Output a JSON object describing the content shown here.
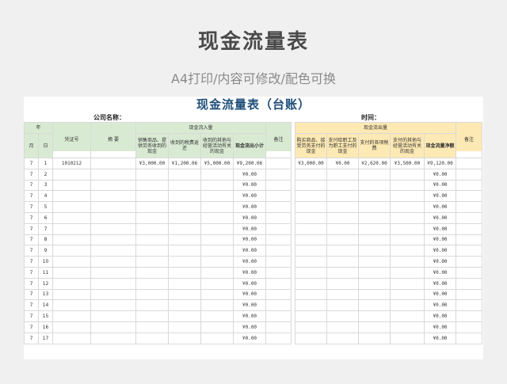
{
  "page": {
    "title": "现金流量表",
    "subtitle": "A4打印/内容可修改/配色可换"
  },
  "sheet": {
    "title": "现金流量表（台账）",
    "company_label": "公司名称：",
    "time_label": "时间："
  },
  "left_table": {
    "year_label": "年",
    "month_label": "月",
    "day_label": "日",
    "voucher_label": "凭证号",
    "summary_label": "摘  要",
    "group_label": "现金流入量",
    "columns": [
      "销售商品、提供劳务收到的现金",
      "收到的税费返还",
      "收到的其他与经营活动有关的现金",
      "现金流出小计",
      "备注"
    ]
  },
  "right_table": {
    "group_label": "现金流出量",
    "columns": [
      "购买商品、接受劳务支付的现金",
      "支付给职工及为职工支付的现金",
      "支付的各项税费",
      "支付的其他与经营活动有关的现金",
      "现金流量净额",
      "备注"
    ]
  },
  "rows": [
    {
      "month": "7",
      "day": "1",
      "voucher": "1010212",
      "sales": "¥3,000.00",
      "refund": "¥1,200.06",
      "other_in": "¥5,000.00",
      "subtotal": "¥9,200.06",
      "buy": "¥3,000.00",
      "staff": "¥0.00",
      "tax": "¥2,620.00",
      "other_out": "¥3,500.00",
      "net": "¥9,120.00"
    },
    {
      "month": "7",
      "day": "2",
      "voucher": "",
      "sales": "",
      "refund": "",
      "other_in": "",
      "subtotal": "¥0.00",
      "buy": "",
      "staff": "",
      "tax": "",
      "other_out": "",
      "net": "¥0.00"
    },
    {
      "month": "7",
      "day": "3",
      "voucher": "",
      "sales": "",
      "refund": "",
      "other_in": "",
      "subtotal": "¥0.00",
      "buy": "",
      "staff": "",
      "tax": "",
      "other_out": "",
      "net": "¥0.00"
    },
    {
      "month": "7",
      "day": "4",
      "voucher": "",
      "sales": "",
      "refund": "",
      "other_in": "",
      "subtotal": "¥0.00",
      "buy": "",
      "staff": "",
      "tax": "",
      "other_out": "",
      "net": "¥0.00"
    },
    {
      "month": "7",
      "day": "5",
      "voucher": "",
      "sales": "",
      "refund": "",
      "other_in": "",
      "subtotal": "¥0.00",
      "buy": "",
      "staff": "",
      "tax": "",
      "other_out": "",
      "net": "¥0.00"
    },
    {
      "month": "7",
      "day": "6",
      "voucher": "",
      "sales": "",
      "refund": "",
      "other_in": "",
      "subtotal": "¥0.00",
      "buy": "",
      "staff": "",
      "tax": "",
      "other_out": "",
      "net": "¥0.00"
    },
    {
      "month": "7",
      "day": "7",
      "voucher": "",
      "sales": "",
      "refund": "",
      "other_in": "",
      "subtotal": "¥0.00",
      "buy": "",
      "staff": "",
      "tax": "",
      "other_out": "",
      "net": "¥0.00"
    },
    {
      "month": "7",
      "day": "8",
      "voucher": "",
      "sales": "",
      "refund": "",
      "other_in": "",
      "subtotal": "¥0.00",
      "buy": "",
      "staff": "",
      "tax": "",
      "other_out": "",
      "net": "¥0.00"
    },
    {
      "month": "7",
      "day": "9",
      "voucher": "",
      "sales": "",
      "refund": "",
      "other_in": "",
      "subtotal": "¥0.00",
      "buy": "",
      "staff": "",
      "tax": "",
      "other_out": "",
      "net": "¥0.00"
    },
    {
      "month": "7",
      "day": "10",
      "voucher": "",
      "sales": "",
      "refund": "",
      "other_in": "",
      "subtotal": "¥0.00",
      "buy": "",
      "staff": "",
      "tax": "",
      "other_out": "",
      "net": "¥0.00"
    },
    {
      "month": "7",
      "day": "11",
      "voucher": "",
      "sales": "",
      "refund": "",
      "other_in": "",
      "subtotal": "¥0.00",
      "buy": "",
      "staff": "",
      "tax": "",
      "other_out": "",
      "net": "¥0.00"
    },
    {
      "month": "7",
      "day": "12",
      "voucher": "",
      "sales": "",
      "refund": "",
      "other_in": "",
      "subtotal": "¥0.00",
      "buy": "",
      "staff": "",
      "tax": "",
      "other_out": "",
      "net": "¥0.00"
    },
    {
      "month": "7",
      "day": "13",
      "voucher": "",
      "sales": "",
      "refund": "",
      "other_in": "",
      "subtotal": "¥0.00",
      "buy": "",
      "staff": "",
      "tax": "",
      "other_out": "",
      "net": "¥0.00"
    },
    {
      "month": "7",
      "day": "14",
      "voucher": "",
      "sales": "",
      "refund": "",
      "other_in": "",
      "subtotal": "¥0.00",
      "buy": "",
      "staff": "",
      "tax": "",
      "other_out": "",
      "net": "¥0.00"
    },
    {
      "month": "7",
      "day": "15",
      "voucher": "",
      "sales": "",
      "refund": "",
      "other_in": "",
      "subtotal": "¥0.00",
      "buy": "",
      "staff": "",
      "tax": "",
      "other_out": "",
      "net": "¥0.00"
    },
    {
      "month": "7",
      "day": "16",
      "voucher": "",
      "sales": "",
      "refund": "",
      "other_in": "",
      "subtotal": "¥0.00",
      "buy": "",
      "staff": "",
      "tax": "",
      "other_out": "",
      "net": "¥0.00"
    },
    {
      "month": "7",
      "day": "17",
      "voucher": "",
      "sales": "",
      "refund": "",
      "other_in": "",
      "subtotal": "¥0.00",
      "buy": "",
      "staff": "",
      "tax": "",
      "other_out": "",
      "net": "¥0.00"
    }
  ]
}
